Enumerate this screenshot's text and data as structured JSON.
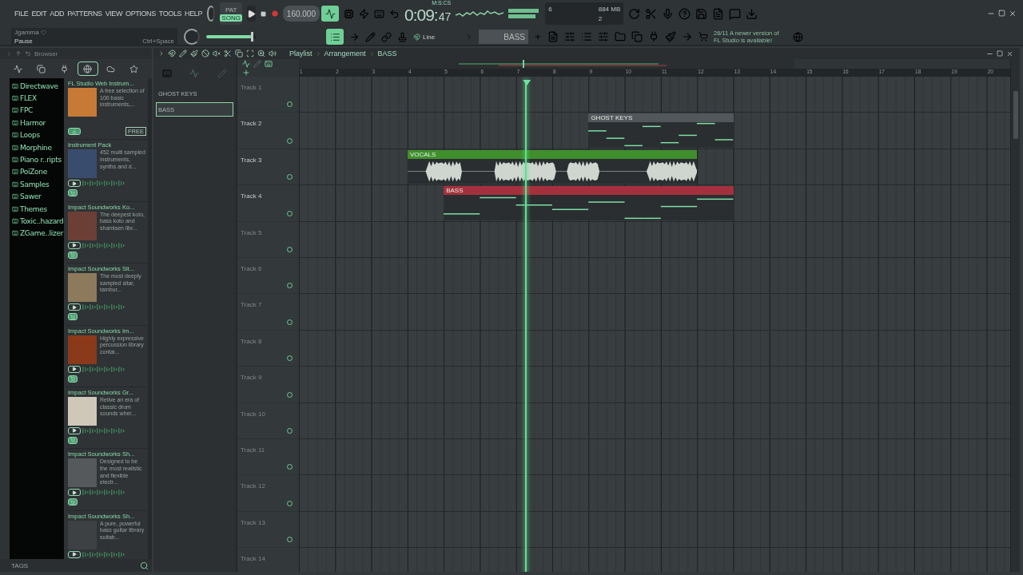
{
  "menu": [
    "FILE",
    "EDIT",
    "ADD",
    "PATTERNS",
    "VIEW",
    "OPTIONS",
    "TOOLS",
    "HELP"
  ],
  "hint": {
    "title": "Jgamma",
    "action": "Pause",
    "shortcut": "Ctrl+Space"
  },
  "mode": [
    {
      "label": "PAT",
      "selected": false
    },
    {
      "label": "SONG",
      "selected": true
    }
  ],
  "tempo": "160.000",
  "clock": {
    "unit": "M:S:CS",
    "time": "0:09:",
    "centiseconds": "47"
  },
  "monitor": {
    "cpu": "6",
    "memory": "884 MB",
    "polyphony": "2"
  },
  "master_slider": {
    "level": 0.92
  },
  "snap": "Line",
  "current_pattern": "BASS",
  "news": "26/11  A newer version of FL Studio is available!",
  "browser": {
    "title": "Browser",
    "tabs": [
      {
        "kind": "waveform",
        "selected": false
      },
      {
        "kind": "files",
        "selected": false
      },
      {
        "kind": "plugin",
        "selected": false
      },
      {
        "kind": "online",
        "selected": true
      },
      {
        "kind": "cloud",
        "selected": false
      },
      {
        "kind": "star",
        "selected": false
      }
    ],
    "folders": [
      "Directwave",
      "FLEX",
      "FPC",
      "Harmor",
      "Loops",
      "Morphine",
      "Piano r..ripts",
      "PoiZone",
      "Samples",
      "Sawer",
      "Themes",
      "Toxic..hazard",
      "ZGame..lizer"
    ],
    "store": [
      {
        "kind": "free",
        "title": "FL Studio Web Instrum...",
        "description": "A free selection of 100 basic instruments,...",
        "badge": "FREE"
      },
      {
        "kind": "preview",
        "title": "Instrument Pack",
        "description": "452 multi sampled instruments, synths and d..."
      },
      {
        "kind": "preview",
        "title": "Impact Soundworks Ko...",
        "description": "The deepest koto, bass koto and shamisen libr..."
      },
      {
        "kind": "preview",
        "title": "Impact Soundworks Sit...",
        "description": "The most deeply sampled sitar, tambur..."
      },
      {
        "kind": "preview",
        "title": "Impact Soundworks Im...",
        "description": "Highly expressive percussion library contai..."
      },
      {
        "kind": "preview",
        "title": "Impact Soundworks Gr...",
        "description": "Relive an era of classic drum sounds wher..."
      },
      {
        "kind": "preview",
        "title": "Impact Soundworks Sh...",
        "description": "Designed to be the most realistic and flexible electr..."
      },
      {
        "kind": "preview",
        "title": "Impact Soundworks Sh...",
        "description": "A pure, powerful bass guitar library suitab..."
      }
    ],
    "footer": "TAGS"
  },
  "playlist": {
    "breadcrumb": [
      "Playlist",
      "Arrangement",
      "BASS"
    ],
    "patterns": [
      {
        "name": "GHOST KEYS",
        "selected": false
      },
      {
        "name": "BASS",
        "selected": true
      }
    ],
    "bars": [
      "1",
      "2",
      "3",
      "4",
      "5",
      "6",
      "7",
      "8",
      "9",
      "10",
      "11",
      "12",
      "13",
      "14",
      "15",
      "16",
      "17",
      "18",
      "19",
      "20"
    ],
    "playhead": {
      "level": 0.32
    },
    "tracks": [
      {
        "name": "Track 1",
        "active": false
      },
      {
        "name": "Track 2",
        "active": true,
        "clips": [
          {
            "name": "GHOST KEYS",
            "kind": "pattern",
            "color": "#51575a"
          }
        ]
      },
      {
        "name": "Track 3",
        "active": true,
        "clips": [
          {
            "name": "VOCALS",
            "kind": "audio",
            "color": "#3f8f2c"
          }
        ]
      },
      {
        "name": "Track 4",
        "active": true,
        "clips": [
          {
            "name": "BASS",
            "kind": "pattern",
            "color": "#a5303d"
          }
        ]
      },
      {
        "name": "Track 5",
        "active": false
      },
      {
        "name": "Track 6",
        "active": false
      },
      {
        "name": "Track 7",
        "active": false
      },
      {
        "name": "Track 8",
        "active": false
      },
      {
        "name": "Track 9",
        "active": false
      },
      {
        "name": "Track 10",
        "active": false
      },
      {
        "name": "Track 11",
        "active": false
      },
      {
        "name": "Track 12",
        "active": false
      },
      {
        "name": "Track 13",
        "active": false
      },
      {
        "name": "Track 14",
        "active": false
      }
    ]
  }
}
